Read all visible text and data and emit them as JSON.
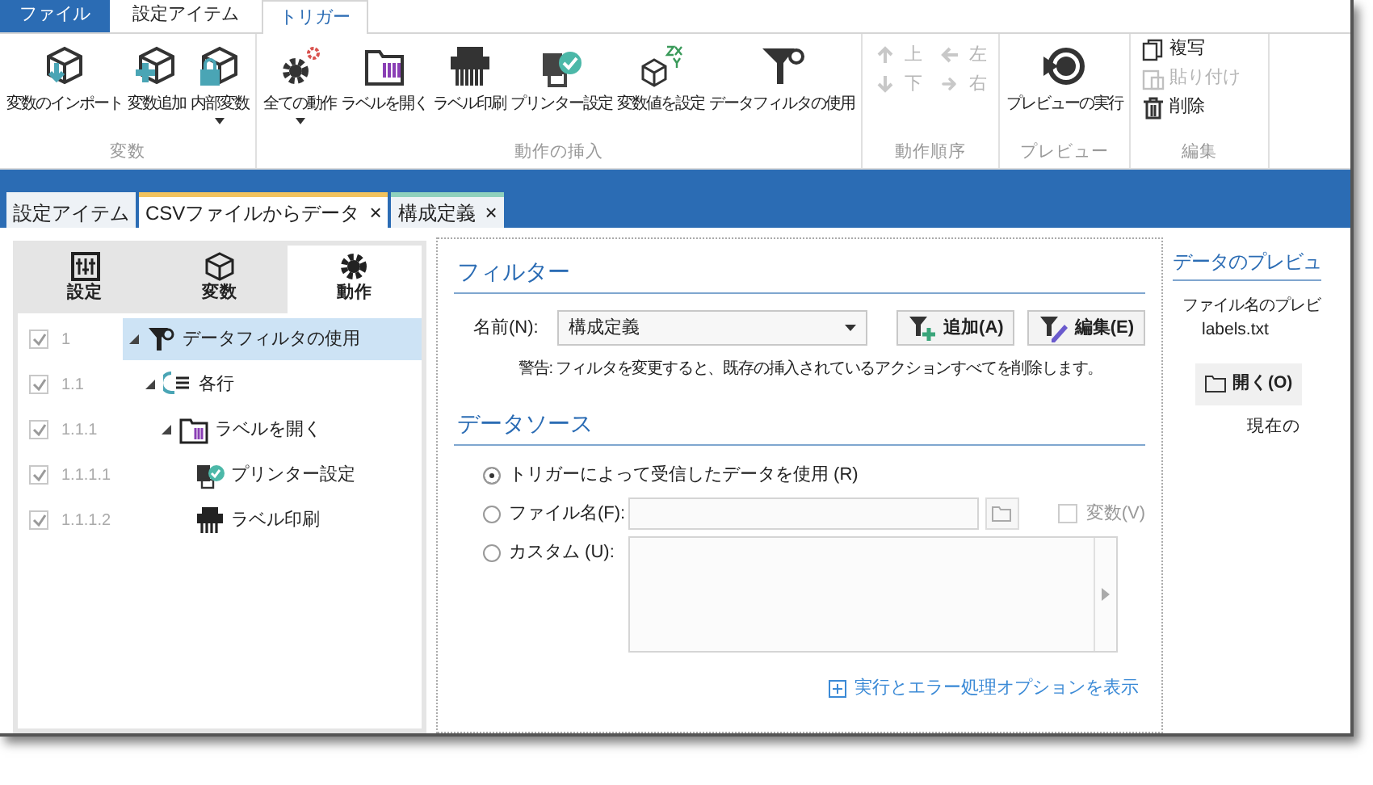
{
  "menu_tabs": [
    {
      "label": "ファイル",
      "kind": "file",
      "selected": false
    },
    {
      "label": "設定アイテム",
      "kind": "tab",
      "selected": false
    },
    {
      "label": "トリガー",
      "kind": "tab",
      "selected": true
    }
  ],
  "ribbon_groups": [
    {
      "label": "変数",
      "kind": "large",
      "buttons": [
        {
          "label": "変数のインポート",
          "dropdown": false
        },
        {
          "label": "変数追加",
          "dropdown": false
        },
        {
          "label": "内部変数",
          "dropdown": true
        }
      ]
    },
    {
      "label": "動作の挿入",
      "kind": "large",
      "buttons": [
        {
          "label": "全ての動作",
          "dropdown": true
        },
        {
          "label": "ラベルを開く",
          "dropdown": false
        },
        {
          "label": "ラベル印刷",
          "dropdown": false
        },
        {
          "label": "プリンター設定",
          "dropdown": false
        },
        {
          "label": "変数値を設定",
          "dropdown": false
        },
        {
          "label": "データフィルタの使用",
          "dropdown": false
        }
      ]
    },
    {
      "label": "動作順序",
      "kind": "arrows",
      "buttons": [
        {
          "label": "上",
          "disabled": true
        },
        {
          "label": "左",
          "disabled": true
        },
        {
          "label": "下",
          "disabled": true
        },
        {
          "label": "右",
          "disabled": true
        }
      ]
    },
    {
      "label": "プレビュー",
      "kind": "large",
      "buttons": [
        {
          "label": "プレビューの実行",
          "dropdown": false
        }
      ]
    },
    {
      "label": "編集",
      "kind": "small",
      "buttons": [
        {
          "label": "複写",
          "disabled": false
        },
        {
          "label": "貼り付け",
          "disabled": true
        },
        {
          "label": "削除",
          "disabled": false
        }
      ]
    }
  ],
  "document_tabs": [
    {
      "label": "設定アイテム",
      "closable": false,
      "selected": false
    },
    {
      "label": "CSVファイルからデータ",
      "closable": true,
      "close": "×",
      "selected": true,
      "color": "#f2c35e"
    },
    {
      "label": "構成定義",
      "closable": true,
      "close": "×",
      "selected": false,
      "color": "#8fd1bd"
    }
  ],
  "side_tabs": [
    {
      "label": "設定",
      "selected": false
    },
    {
      "label": "変数",
      "selected": false
    },
    {
      "label": "動作",
      "selected": true
    }
  ],
  "tree": [
    {
      "number": "1",
      "label": "データフィルタの使用",
      "kind": "filter",
      "checked": true,
      "expanded": true,
      "selected": true,
      "children": [
        {
          "number": "1.1",
          "label": "各行",
          "kind": "loop",
          "checked": true,
          "expanded": true,
          "selected": false,
          "children": [
            {
              "number": "1.1.1",
              "label": "ラベルを開く",
              "kind": "open",
              "checked": true,
              "expanded": true,
              "selected": false,
              "children": [
                {
                  "number": "1.1.1.1",
                  "label": "プリンター設定",
                  "kind": "printer",
                  "checked": true,
                  "selected": false
                },
                {
                  "number": "1.1.1.2",
                  "label": "ラベル印刷",
                  "kind": "print",
                  "checked": true,
                  "selected": false
                }
              ]
            }
          ]
        }
      ]
    }
  ],
  "filter": {
    "heading": "フィルター",
    "name_label": "名前(N):",
    "name_value": "構成定義",
    "buttons": [
      {
        "label": "追加(A)",
        "kind": "add"
      },
      {
        "label": "編集(E)",
        "kind": "edit"
      }
    ],
    "warning": "警告: フィルタを変更すると、既存の挿入されているアクションすべてを削除します。"
  },
  "data_source": {
    "heading": "データソース",
    "options": [
      {
        "label": "トリガーによって受信したデータを使用 (R)",
        "kind": "plain",
        "selected": true
      },
      {
        "label": "ファイル名(F):",
        "kind": "file",
        "selected": false
      },
      {
        "label": "カスタム (U):",
        "kind": "text",
        "selected": false
      }
    ],
    "variable_checkbox": {
      "label": "変数(V)",
      "checked": false
    }
  },
  "options_link": "実行とエラー処理オプションを表示",
  "preview": {
    "heading": "データのプレビュ",
    "file_label": "ファイル名のプレビ",
    "file_value": "labels.txt",
    "open_button": "開く(O)",
    "current_label": "現在の"
  }
}
